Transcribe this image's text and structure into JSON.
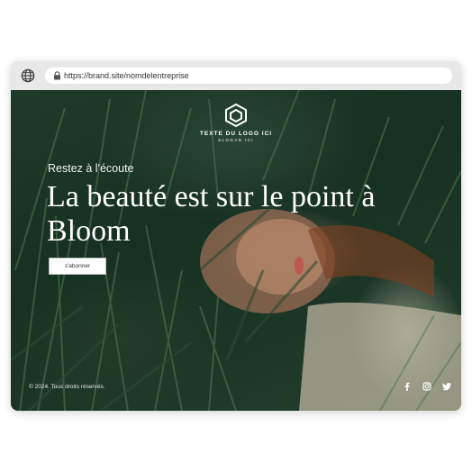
{
  "browser": {
    "url": "https://brand.site/nomdelentreprise",
    "icons": [
      "globe-icon",
      "lock-icon"
    ]
  },
  "hero": {
    "logo_text": "TEXTE DU LOGO ICI",
    "logo_slogan": "SLOGAN ICI",
    "eyebrow": "Restez à l'écoute",
    "headline": "La beauté est sur le point à Bloom",
    "cta_label": "s'abonner"
  },
  "footer": {
    "copyright": "© 2024. Tous droits réservés.",
    "social_icons": [
      "facebook-icon",
      "instagram-icon",
      "twitter-icon"
    ]
  },
  "colors": {
    "hero_green": "#1c3626",
    "text_white": "#ffffff",
    "browser_bar": "#e8e8e8"
  }
}
